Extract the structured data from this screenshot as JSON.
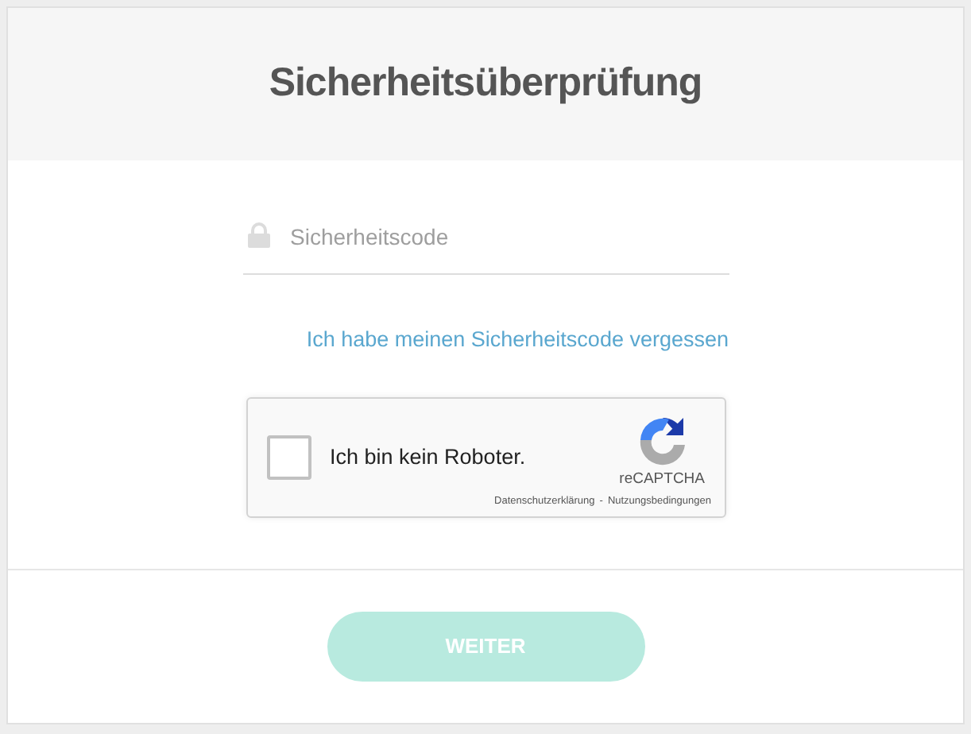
{
  "title": "Sicherheitsüberprüfung",
  "code_field": {
    "placeholder": "Sicherheitscode"
  },
  "forgot_link": "Ich habe meinen Sicherheitscode vergessen",
  "captcha": {
    "label": "Ich bin kein Roboter.",
    "checked": false,
    "brand": "reCAPTCHA",
    "privacy": "Datenschutzerklärung",
    "separator": "-",
    "terms": "Nutzungsbedingungen"
  },
  "submit": {
    "label": "WEITER",
    "disabled": true
  }
}
